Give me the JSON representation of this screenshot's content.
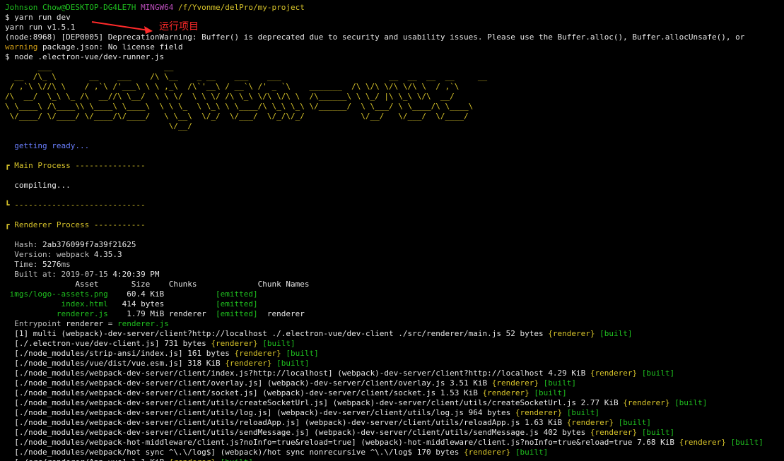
{
  "prompt": {
    "user_host": "Johnson Chow@DESKTOP-DG4LE7H",
    "system": "MINGW64",
    "path": "/f/Yvonme/delPro/my-project"
  },
  "pre": [
    {
      "kind": "cmd",
      "text": "$ yarn run dev"
    },
    {
      "kind": "plain",
      "text": "yarn run v1.5.1"
    },
    {
      "kind": "plain",
      "text": "(node:8968) [DEP0005] DeprecationWarning: Buffer() is deprecated due to security and usability issues. Please use the Buffer.alloc(), Buffer.allocUnsafe(), or"
    },
    {
      "kind": "warning",
      "prefix": "warning",
      "text": " package.json: No license field"
    },
    {
      "kind": "cmd",
      "text": "$ node .electron-vue/dev-runner.js"
    }
  ],
  "annotation": "运行项目",
  "banner": [
    "       ___                        __",
    "  __  /\\_ \\       __    ___    /\\ \\__    _ __    ___    ___                       __  __  __  __     __",
    " / ,`\\ \\//\\ \\    / ,`\\ /'___\\ \\ \\ ,_\\  /\\`'__\\ / __`\\ /' _ `\\    _______  /\\ \\/\\ \\/\\ \\/\\ \\  / ,`\\",
    "/\\  __/  \\_\\ \\_ /\\  __//\\ \\__/  \\ \\ \\/  \\ \\ \\/ /\\ \\_\\ \\/\\ \\/\\ \\  /\\______\\ \\ \\_/ |\\ \\_\\ \\/\\  __/",
    "\\ \\____\\ /\\____\\\\ \\____\\ \\____\\  \\ \\ \\_  \\ \\_\\ \\ \\____/\\ \\_\\ \\_\\ \\/______/  \\ \\___/ \\ \\____/\\ \\____\\",
    " \\/____/ \\/____/ \\/____/\\/____/   \\ \\__\\  \\/_/  \\/___/  \\/_/\\/_/            \\/__/   \\/___/  \\/____/",
    "                                   \\/__/"
  ],
  "getting_ready": "getting ready...",
  "main_process": {
    "header_corner": "┏",
    "header": " Main Process ---------------",
    "status": "compiling...",
    "footer": "┗ ----------------------------"
  },
  "renderer_process": {
    "header_corner": "┏",
    "header": " Renderer Process -----------",
    "hash_label": "Hash: ",
    "hash": "2ab376099f7a39f21625",
    "version_label": "Version: webpack ",
    "version": "4.35.3",
    "time_label": "Time: ",
    "time": "5276",
    "time_unit": "ms",
    "built_label": "Built at: 2019-07-15 ",
    "built_time": "4:20:39 PM",
    "table_header": "               Asset       Size    Chunks             Chunk Names",
    "assets": [
      {
        "asset": "imgs/logo--assets.png",
        "size": "60.4 KiB",
        "chunks": "",
        "emitted": "[emitted]",
        "names": ""
      },
      {
        "asset": "index.html",
        "size": "414 bytes",
        "chunks": "",
        "emitted": "[emitted]",
        "names": ""
      },
      {
        "asset": "renderer.js",
        "size": "1.79 MiB",
        "chunks": "renderer",
        "emitted": "[emitted]",
        "names": "renderer"
      }
    ],
    "entrypoint_label": "Entrypoint ",
    "entrypoint_name": "renderer",
    "entrypoint_eq": " = ",
    "entrypoint_file": "renderer.js"
  },
  "modules": [
    {
      "path": "[1] multi (webpack)-dev-server/client?http://localhost ./.electron-vue/dev-client ./src/renderer/main.js",
      "size": "52 bytes"
    },
    {
      "path": "[./.electron-vue/dev-client.js]",
      "size": "731 bytes"
    },
    {
      "path": "[./node_modules/strip-ansi/index.js]",
      "size": "161 bytes"
    },
    {
      "path": "[./node_modules/vue/dist/vue.esm.js]",
      "size": "318 KiB"
    },
    {
      "path": "[./node_modules/webpack-dev-server/client/index.js?http://localhost] (webpack)-dev-server/client?http://localhost",
      "size": "4.29 KiB"
    },
    {
      "path": "[./node_modules/webpack-dev-server/client/overlay.js] (webpack)-dev-server/client/overlay.js",
      "size": "3.51 KiB"
    },
    {
      "path": "[./node_modules/webpack-dev-server/client/socket.js] (webpack)-dev-server/client/socket.js",
      "size": "1.53 KiB"
    },
    {
      "path": "[./node_modules/webpack-dev-server/client/utils/createSocketUrl.js] (webpack)-dev-server/client/utils/createSocketUrl.js",
      "size": "2.77 KiB"
    },
    {
      "path": "[./node_modules/webpack-dev-server/client/utils/log.js] (webpack)-dev-server/client/utils/log.js",
      "size": "964 bytes"
    },
    {
      "path": "[./node_modules/webpack-dev-server/client/utils/reloadApp.js] (webpack)-dev-server/client/utils/reloadApp.js",
      "size": "1.63 KiB"
    },
    {
      "path": "[./node_modules/webpack-dev-server/client/utils/sendMessage.js] (webpack)-dev-server/client/utils/sendMessage.js",
      "size": "402 bytes"
    },
    {
      "path": "[./node_modules/webpack-hot-middleware/client.js?noInfo=true&reload=true] (webpack)-hot-middleware/client.js?noInfo=true&reload=true",
      "size": "7.68 KiB"
    },
    {
      "path": "[./node_modules/webpack/hot sync ^\\.\\/log$] (webpack)/hot sync nonrecursive ^\\.\\/log$",
      "size": "170 bytes"
    },
    {
      "path": "[./src/renderer/App.vue]",
      "size": "1.1 KiB"
    }
  ],
  "chunk_tag": "{renderer}",
  "built_tag": "[built]",
  "colors": {
    "green": "#1fbf1f",
    "magenta": "#c050c0",
    "yellow": "#d7c32a",
    "blue": "#6a7fff",
    "annotation": "#ff2a2a",
    "background": "#000000"
  }
}
